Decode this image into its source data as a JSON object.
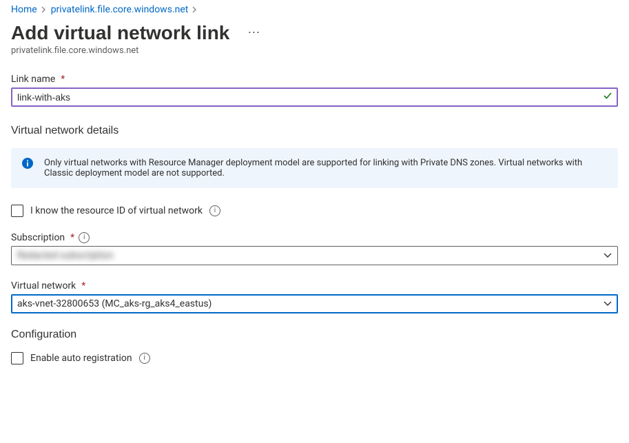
{
  "breadcrumb": {
    "home": "Home",
    "zone": "privatelink.file.core.windows.net"
  },
  "title": "Add virtual network link",
  "subtitle": "privatelink.file.core.windows.net",
  "linkName": {
    "label": "Link name",
    "value": "link-with-aks"
  },
  "vnetDetails": {
    "heading": "Virtual network details",
    "info": "Only virtual networks with Resource Manager deployment model are supported for linking with Private DNS zones. Virtual networks with Classic deployment model are not supported."
  },
  "resourceIdCheckbox": {
    "label": "I know the resource ID of virtual network"
  },
  "subscription": {
    "label": "Subscription",
    "value": "Redacted subscription"
  },
  "vnet": {
    "label": "Virtual network",
    "value": "aks-vnet-32800653 (MC_aks-rg_aks4_eastus)"
  },
  "configuration": {
    "heading": "Configuration",
    "autoReg": "Enable auto registration"
  }
}
